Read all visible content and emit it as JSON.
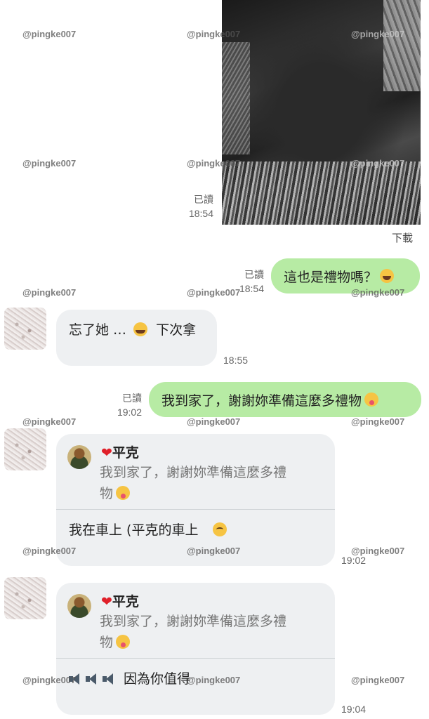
{
  "watermark": "@pingke007",
  "image_msg": {
    "read": "已讀",
    "time": "18:54",
    "download": "下載"
  },
  "msg1": {
    "text": "這也是禮物嗎？",
    "emoji": "laughing-emoji",
    "read": "已讀",
    "time": "18:54"
  },
  "msg2": {
    "text": "忘了她 …",
    "text_after": "下次拿",
    "emoji": "crying-laughing-emoji",
    "time": "18:55"
  },
  "msg3": {
    "text": "我到家了，謝謝妳準備這麼多禮物",
    "emoji": "tongue-emoji",
    "read": "已讀",
    "time": "19:02"
  },
  "reply1": {
    "quote_name": "平克",
    "quote_line1": "我到家了，謝謝妳準備這麼多禮",
    "quote_line2": "物",
    "text": "我在車上 (平克的車上",
    "emoji": "pleading-emoji",
    "time": "19:02"
  },
  "reply2": {
    "quote_name": "平克",
    "quote_line1": "我到家了，謝謝妳準備這麼多禮",
    "quote_line2": "物",
    "text": "因為你值得",
    "icon": "speaker-icon",
    "time": "19:04"
  }
}
